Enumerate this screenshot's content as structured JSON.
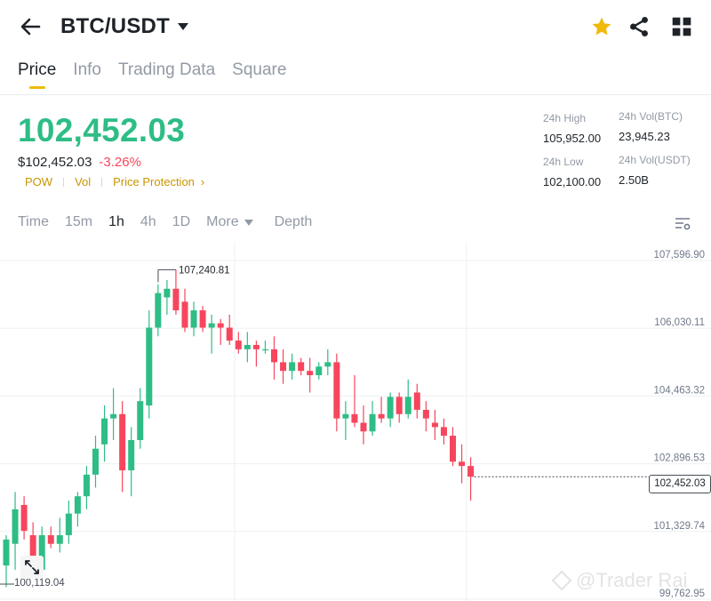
{
  "header": {
    "back_icon": "back-arrow-icon",
    "pair": "BTC/USDT",
    "icons": [
      "star-icon",
      "share-icon",
      "grid-icon"
    ],
    "star_color": "#f0b90b"
  },
  "tabs": [
    "Price",
    "Info",
    "Trading Data",
    "Square"
  ],
  "ticker": {
    "last_price": "102,452.03",
    "usd_price": "$102,452.03",
    "change": "-3.26%",
    "tags": [
      "POW",
      "Vol",
      "Price Protection"
    ],
    "high_label": "24h High",
    "high_value": "105,952.00",
    "low_label": "24h Low",
    "low_value": "102,100.00",
    "vol_btc_label": "24h Vol(BTC)",
    "vol_btc_value": "23,945.23",
    "vol_usdt_label": "24h Vol(USDT)",
    "vol_usdt_value": "2.50B"
  },
  "intervals": [
    "Time",
    "15m",
    "1h",
    "4h",
    "1D",
    "More",
    "Depth"
  ],
  "selected_interval": "1h",
  "colors": {
    "up": "#2ebd85",
    "down": "#f6465d",
    "accent": "#f0b90b"
  },
  "chart_data": {
    "type": "candlestick",
    "y_ticks": [
      "107,596.90",
      "106,030.11",
      "104,463.32",
      "102,896.53",
      "101,329.74",
      "99,762.95"
    ],
    "ylim": [
      99762.95,
      107596.9
    ],
    "last_price_tag": "102,452.03",
    "max_label": "107,240.81",
    "min_label": "100,119.04",
    "watermark": "@Trader Rai",
    "candles": [
      {
        "o": 100400,
        "h": 101100,
        "l": 99900,
        "c": 101000
      },
      {
        "o": 100900,
        "h": 102100,
        "l": 100300,
        "c": 101700
      },
      {
        "o": 101800,
        "h": 102000,
        "l": 101000,
        "c": 101200
      },
      {
        "o": 101100,
        "h": 101400,
        "l": 100100,
        "c": 100300
      },
      {
        "o": 100300,
        "h": 101300,
        "l": 100150,
        "c": 101100
      },
      {
        "o": 101100,
        "h": 101300,
        "l": 100800,
        "c": 100900
      },
      {
        "o": 100900,
        "h": 101500,
        "l": 100700,
        "c": 101100
      },
      {
        "o": 101100,
        "h": 101900,
        "l": 100900,
        "c": 101600
      },
      {
        "o": 101600,
        "h": 102100,
        "l": 101300,
        "c": 102000
      },
      {
        "o": 102000,
        "h": 102700,
        "l": 101700,
        "c": 102500
      },
      {
        "o": 102500,
        "h": 103400,
        "l": 102200,
        "c": 103100
      },
      {
        "o": 103200,
        "h": 104100,
        "l": 102800,
        "c": 103800
      },
      {
        "o": 103800,
        "h": 104500,
        "l": 103300,
        "c": 103900
      },
      {
        "o": 103900,
        "h": 104200,
        "l": 102100,
        "c": 102600
      },
      {
        "o": 102600,
        "h": 103600,
        "l": 102000,
        "c": 103300
      },
      {
        "o": 103300,
        "h": 104500,
        "l": 103100,
        "c": 104200
      },
      {
        "o": 104100,
        "h": 106300,
        "l": 103800,
        "c": 105900
      },
      {
        "o": 105900,
        "h": 106900,
        "l": 105700,
        "c": 106700
      },
      {
        "o": 106600,
        "h": 107000,
        "l": 106200,
        "c": 106800
      },
      {
        "o": 106800,
        "h": 107240.81,
        "l": 106200,
        "c": 106300
      },
      {
        "o": 106500,
        "h": 106800,
        "l": 105800,
        "c": 105900
      },
      {
        "o": 105900,
        "h": 106500,
        "l": 105700,
        "c": 106300
      },
      {
        "o": 106300,
        "h": 106400,
        "l": 105800,
        "c": 105900
      },
      {
        "o": 105900,
        "h": 106200,
        "l": 105300,
        "c": 106000
      },
      {
        "o": 106000,
        "h": 106100,
        "l": 105500,
        "c": 105900
      },
      {
        "o": 105900,
        "h": 106200,
        "l": 105500,
        "c": 105600
      },
      {
        "o": 105600,
        "h": 105800,
        "l": 105300,
        "c": 105400
      },
      {
        "o": 105400,
        "h": 105800,
        "l": 105100,
        "c": 105500
      },
      {
        "o": 105500,
        "h": 105600,
        "l": 105000,
        "c": 105400
      },
      {
        "o": 105400,
        "h": 105600,
        "l": 105300,
        "c": 105400
      },
      {
        "o": 105400,
        "h": 105700,
        "l": 104700,
        "c": 105100
      },
      {
        "o": 105100,
        "h": 105400,
        "l": 104600,
        "c": 104900
      },
      {
        "o": 104900,
        "h": 105300,
        "l": 104700,
        "c": 105100
      },
      {
        "o": 105100,
        "h": 105200,
        "l": 104800,
        "c": 104900
      },
      {
        "o": 104900,
        "h": 105200,
        "l": 104400,
        "c": 104800
      },
      {
        "o": 104800,
        "h": 105100,
        "l": 104700,
        "c": 105000
      },
      {
        "o": 105000,
        "h": 105400,
        "l": 104800,
        "c": 105100
      },
      {
        "o": 105100,
        "h": 105300,
        "l": 103500,
        "c": 103800
      },
      {
        "o": 103800,
        "h": 104200,
        "l": 103300,
        "c": 103900
      },
      {
        "o": 103900,
        "h": 104800,
        "l": 103600,
        "c": 103700
      },
      {
        "o": 103700,
        "h": 104100,
        "l": 103200,
        "c": 103500
      },
      {
        "o": 103500,
        "h": 104200,
        "l": 103400,
        "c": 103900
      },
      {
        "o": 103900,
        "h": 104300,
        "l": 103700,
        "c": 103800
      },
      {
        "o": 103800,
        "h": 104400,
        "l": 103600,
        "c": 104300
      },
      {
        "o": 104300,
        "h": 104400,
        "l": 103700,
        "c": 103900
      },
      {
        "o": 103900,
        "h": 104700,
        "l": 103800,
        "c": 104300
      },
      {
        "o": 104400,
        "h": 104600,
        "l": 103800,
        "c": 104000
      },
      {
        "o": 104000,
        "h": 104200,
        "l": 103500,
        "c": 103800
      },
      {
        "o": 103700,
        "h": 104000,
        "l": 103300,
        "c": 103600
      },
      {
        "o": 103600,
        "h": 103800,
        "l": 103200,
        "c": 103400
      },
      {
        "o": 103400,
        "h": 103600,
        "l": 102700,
        "c": 102800
      },
      {
        "o": 102800,
        "h": 103200,
        "l": 102300,
        "c": 102700
      },
      {
        "o": 102700,
        "h": 102900,
        "l": 101900,
        "c": 102452.03
      }
    ]
  }
}
